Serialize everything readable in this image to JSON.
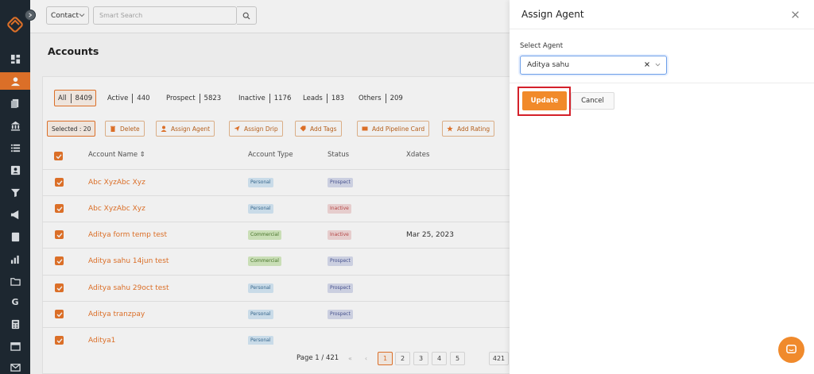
{
  "topbar": {
    "contact_select": "Contact",
    "search_placeholder": "Smart Search"
  },
  "page": {
    "title": "Accounts"
  },
  "filters": [
    {
      "label": "All",
      "count": "8409"
    },
    {
      "label": "Active",
      "count": "440"
    },
    {
      "label": "Prospect",
      "count": "5823"
    },
    {
      "label": "Inactive",
      "count": "1176"
    },
    {
      "label": "Leads",
      "count": "183"
    },
    {
      "label": "Others",
      "count": "209"
    }
  ],
  "actions": {
    "selected": "Selected : 20",
    "delete": "Delete",
    "assign_agent": "Assign Agent",
    "assign_drip": "Assign Drip",
    "add_tags": "Add Tags",
    "add_pipeline_card": "Add Pipeline Card",
    "add_rating": "Add Rating"
  },
  "table": {
    "headers": {
      "account_name": "Account Name ⇕",
      "account_type": "Account Type",
      "status": "Status",
      "xdates": "Xdates"
    },
    "rows": [
      {
        "name": "Abc XyzAbc Xyz",
        "type": "Personal",
        "status": "Prospect",
        "xdate": ""
      },
      {
        "name": "Abc XyzAbc Xyz",
        "type": "Personal",
        "status": "Inactive",
        "xdate": ""
      },
      {
        "name": "Aditya form temp test",
        "type": "Commercial",
        "status": "Inactive",
        "xdate": "Mar 25, 2023"
      },
      {
        "name": "Aditya sahu 14jun test",
        "type": "Commercial",
        "status": "Prospect",
        "xdate": ""
      },
      {
        "name": "Aditya sahu 29oct test",
        "type": "Personal",
        "status": "Prospect",
        "xdate": ""
      },
      {
        "name": "Aditya tranzpay",
        "type": "Personal",
        "status": "Prospect",
        "xdate": ""
      },
      {
        "name": "Aditya1",
        "type": "Personal",
        "status": "",
        "xdate": ""
      }
    ]
  },
  "pagination": {
    "label": "Page 1 / 421",
    "first": "«",
    "prev": "‹",
    "pages": [
      "1",
      "2",
      "3",
      "4",
      "5",
      "421"
    ]
  },
  "drawer": {
    "title": "Assign Agent",
    "select_label": "Select Agent",
    "selected_agent": "Aditya sahu",
    "update": "Update",
    "cancel": "Cancel"
  },
  "colors": {
    "accent": "#e9762b",
    "sidebar": "#1f2a33",
    "highlight": "#d4202a"
  },
  "icons": [
    "logo-icon",
    "dashboard-icon",
    "accounts-icon",
    "documents-icon",
    "bank-icon",
    "list-icon",
    "contacts-icon",
    "filter-icon",
    "megaphone-icon",
    "note-icon",
    "chart-icon",
    "folder-icon",
    "google-icon",
    "calculator-icon",
    "calendar-icon",
    "mail-icon",
    "search-icon",
    "close-icon",
    "chat-icon"
  ]
}
